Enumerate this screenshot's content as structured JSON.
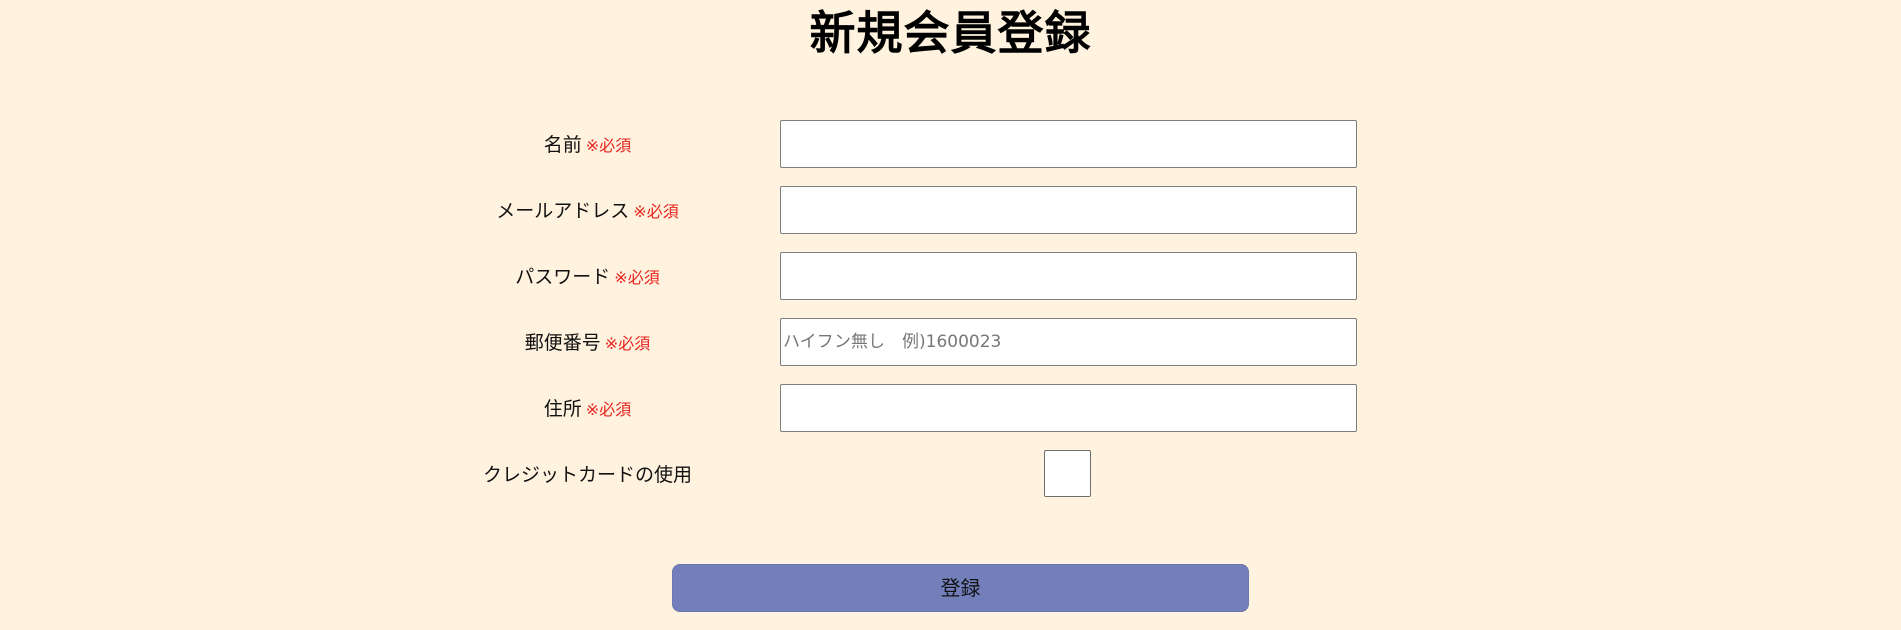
{
  "page": {
    "title": "新規会員登録"
  },
  "form": {
    "fields": [
      {
        "label": "名前",
        "required_mark": "※必須",
        "placeholder": ""
      },
      {
        "label": "メールアドレス",
        "required_mark": "※必須",
        "placeholder": ""
      },
      {
        "label": "パスワード",
        "required_mark": "※必須",
        "placeholder": ""
      },
      {
        "label": "郵便番号",
        "required_mark": "※必須",
        "placeholder": "ハイフン無し　例)1600023"
      },
      {
        "label": "住所",
        "required_mark": "※必須",
        "placeholder": ""
      }
    ],
    "credit_card": {
      "label": "クレジットカードの使用",
      "checked": false
    },
    "submit_label": "登録"
  },
  "colors": {
    "background": "#fff2de",
    "required": "#e8231f",
    "submit_button": "#727fbb"
  }
}
